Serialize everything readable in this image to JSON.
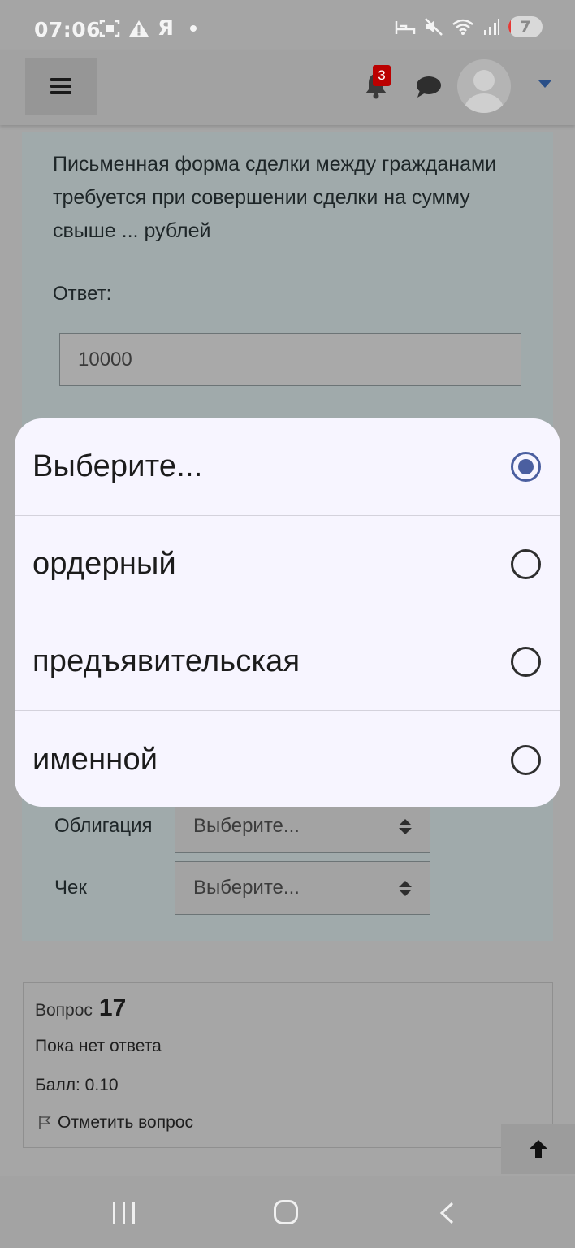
{
  "status_bar": {
    "time": "07:06",
    "carrier_glyph": "Я",
    "battery_level": "7",
    "battery_fraction": 0.07
  },
  "navbar": {
    "notification_count": "3",
    "colors": {
      "badge": "#bb0000",
      "caret": "#2a4f88"
    }
  },
  "question": {
    "text": "Письменная форма сделки между гражданами требуется при совершении сделки на сумму свыше ... рублей",
    "answer_label": "Ответ:",
    "answer_value": "10000"
  },
  "matching": {
    "rows": [
      {
        "label": "Облигация",
        "selected": "Выберите..."
      },
      {
        "label": "Чек",
        "selected": "Выберите..."
      }
    ]
  },
  "next_question": {
    "prefix": "Вопрос",
    "number": "17",
    "state": "Пока нет ответа",
    "score": "Балл: 0.10",
    "flag_label": "Отметить вопрос"
  },
  "dropdown": {
    "options": [
      {
        "label": "Выберите...",
        "checked": true
      },
      {
        "label": "ордерный",
        "checked": false
      },
      {
        "label": "предъявительская",
        "checked": false
      },
      {
        "label": "именной",
        "checked": false
      }
    ],
    "colors": {
      "radio_selected": "#4b5fa0",
      "background": "#f7f5ff"
    }
  }
}
